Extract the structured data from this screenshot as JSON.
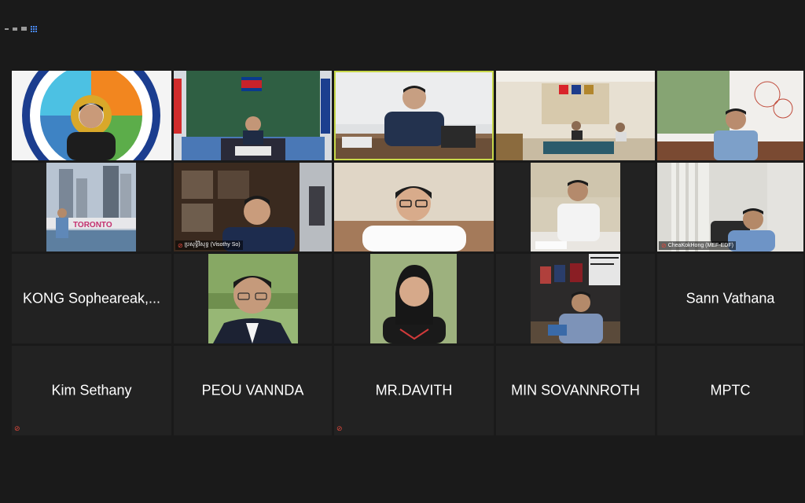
{
  "app": {
    "view_controls": [
      "speaker-view-icon",
      "gallery-view-icon"
    ]
  },
  "tiles": [
    {
      "type": "video",
      "scene": "logo-presenter",
      "label": ""
    },
    {
      "type": "video",
      "scene": "flag-room",
      "label": ""
    },
    {
      "type": "video",
      "scene": "office-desk",
      "label": "",
      "active": true
    },
    {
      "type": "video",
      "scene": "ministry-hall",
      "label": ""
    },
    {
      "type": "video",
      "scene": "sofa-room",
      "label": ""
    },
    {
      "type": "video",
      "scene": "toronto",
      "label": ""
    },
    {
      "type": "video",
      "scene": "bookcase",
      "label": "ប្រសុទ្ធិវិសុទ្ធ (Visothy So)",
      "muted": true
    },
    {
      "type": "video",
      "scene": "glasses-person",
      "label": ""
    },
    {
      "type": "video",
      "scene": "writing-desk",
      "label": ""
    },
    {
      "type": "video",
      "scene": "curtain-room",
      "label": "CheaKokHong (MEF-EDF)",
      "muted": true
    },
    {
      "type": "name",
      "name": "KONG Sopheareak,..."
    },
    {
      "type": "video",
      "scene": "outdoor-portrait",
      "label": ""
    },
    {
      "type": "video",
      "scene": "woman-portrait",
      "label": ""
    },
    {
      "type": "video",
      "scene": "poster-room",
      "label": ""
    },
    {
      "type": "name",
      "name": "Sann Vathana"
    },
    {
      "type": "name",
      "name": "Kim Sethany",
      "muted": true
    },
    {
      "type": "name",
      "name": "PEOU VANNDA"
    },
    {
      "type": "name",
      "name": "MR.DAVITH",
      "muted": true
    },
    {
      "type": "name",
      "name": "MIN SOVANNROTH"
    },
    {
      "type": "name",
      "name": "MPTC"
    }
  ],
  "colors": {
    "background": "#1a1a1a",
    "tile": "#222222",
    "active_border": "#c8d84a",
    "mute": "#e0493d"
  }
}
